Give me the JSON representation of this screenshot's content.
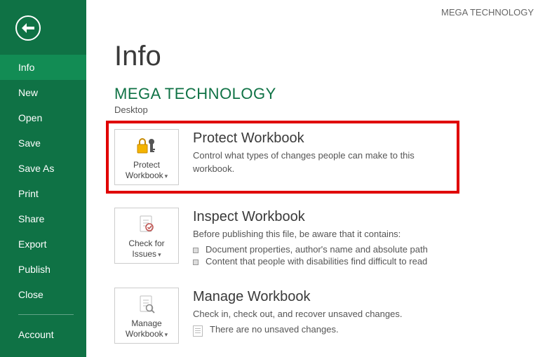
{
  "header": {
    "app_title": "MEGA TECHNOLOGY"
  },
  "sidebar": {
    "items": [
      {
        "label": "Info"
      },
      {
        "label": "New"
      },
      {
        "label": "Open"
      },
      {
        "label": "Save"
      },
      {
        "label": "Save As"
      },
      {
        "label": "Print"
      },
      {
        "label": "Share"
      },
      {
        "label": "Export"
      },
      {
        "label": "Publish"
      },
      {
        "label": "Close"
      }
    ],
    "footer": [
      {
        "label": "Account"
      }
    ]
  },
  "page": {
    "title": "Info",
    "doc_title": "MEGA TECHNOLOGY",
    "doc_location": "Desktop"
  },
  "protect": {
    "tile_label_1": "Protect",
    "tile_label_2": "Workbook",
    "heading": "Protect Workbook",
    "desc": "Control what types of changes people can make to this workbook."
  },
  "inspect": {
    "tile_label_1": "Check for",
    "tile_label_2": "Issues",
    "heading": "Inspect Workbook",
    "desc": "Before publishing this file, be aware that it contains:",
    "bullets": [
      "Document properties, author's name and absolute path",
      "Content that people with disabilities find difficult to read"
    ]
  },
  "manage": {
    "tile_label_1": "Manage",
    "tile_label_2": "Workbook",
    "heading": "Manage Workbook",
    "desc": "Check in, check out, and recover unsaved changes.",
    "status": "There are no unsaved changes."
  }
}
